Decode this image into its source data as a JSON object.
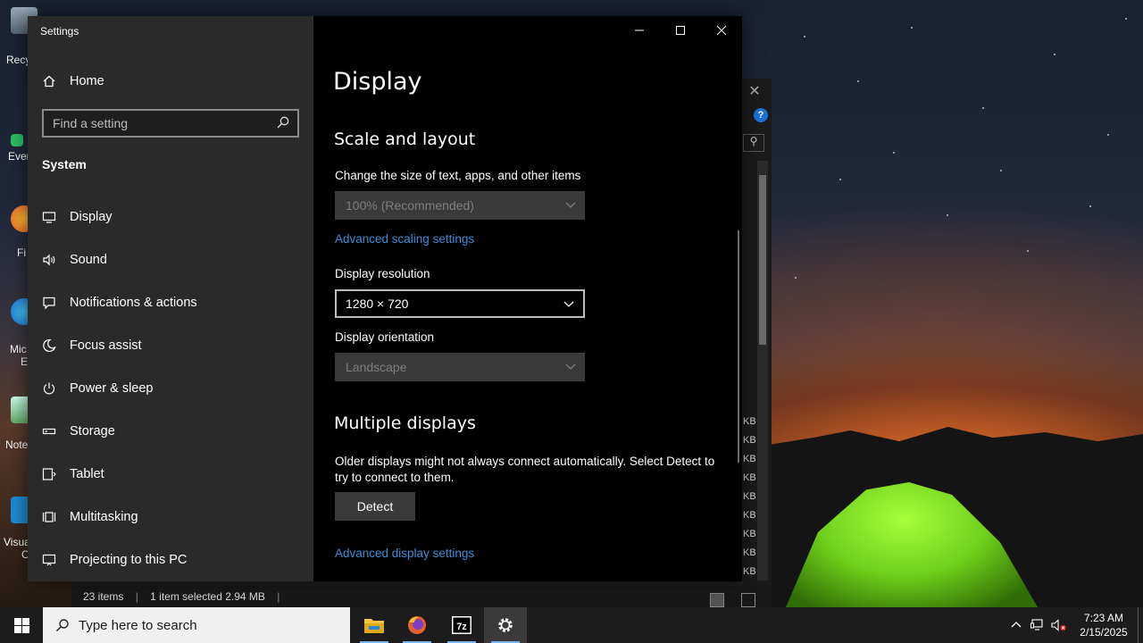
{
  "desktop": {
    "icons": [
      {
        "label": "Recy",
        "name": "recycle-bin"
      },
      {
        "label": "Ever",
        "name": "evernote"
      },
      {
        "label": "Fi",
        "name": "firefox"
      },
      {
        "label": "Mic",
        "label2": "E",
        "name": "microsoft-edge"
      },
      {
        "label": "Note",
        "name": "notepad-plus-plus"
      },
      {
        "label": "Visua",
        "label2": "C",
        "name": "visual-studio-code"
      }
    ]
  },
  "explorer": {
    "kb_units": [
      "KB",
      "KB",
      "KB",
      "KB",
      "KB",
      "KB",
      "KB",
      "KB",
      "KB"
    ],
    "status": {
      "items": "23 items",
      "selected": "1 item selected  2.94 MB"
    }
  },
  "settings": {
    "app_title": "Settings",
    "home_label": "Home",
    "search_placeholder": "Find a setting",
    "section": "System",
    "nav": [
      {
        "label": "Display",
        "icon": "monitor-icon"
      },
      {
        "label": "Sound",
        "icon": "speaker-icon"
      },
      {
        "label": "Notifications & actions",
        "icon": "notification-icon"
      },
      {
        "label": "Focus assist",
        "icon": "moon-icon"
      },
      {
        "label": "Power & sleep",
        "icon": "power-icon"
      },
      {
        "label": "Storage",
        "icon": "storage-icon"
      },
      {
        "label": "Tablet",
        "icon": "tablet-icon"
      },
      {
        "label": "Multitasking",
        "icon": "multitasking-icon"
      },
      {
        "label": "Projecting to this PC",
        "icon": "projecting-icon"
      }
    ],
    "page_title": "Display",
    "scale_layout": {
      "heading": "Scale and layout",
      "scale_label": "Change the size of text, apps, and other items",
      "scale_value": "100% (Recommended)",
      "advanced_scaling_link": "Advanced scaling settings",
      "resolution_label": "Display resolution",
      "resolution_value": "1280 × 720",
      "orientation_label": "Display orientation",
      "orientation_value": "Landscape"
    },
    "multiple_displays": {
      "heading": "Multiple displays",
      "description": "Older displays might not always connect automatically. Select Detect to try to connect to them.",
      "detect_button": "Detect",
      "advanced_display_link": "Advanced display settings"
    }
  },
  "taskbar": {
    "search_placeholder": "Type here to search",
    "pinned": [
      "file-explorer",
      "firefox",
      "7-zip",
      "settings"
    ],
    "clock_time": "7:23 AM",
    "clock_date": "2/15/2025"
  },
  "colors": {
    "accent_link": "#3f8ed8",
    "sidebar_bg": "#2a2a2a",
    "content_bg": "#000000"
  }
}
